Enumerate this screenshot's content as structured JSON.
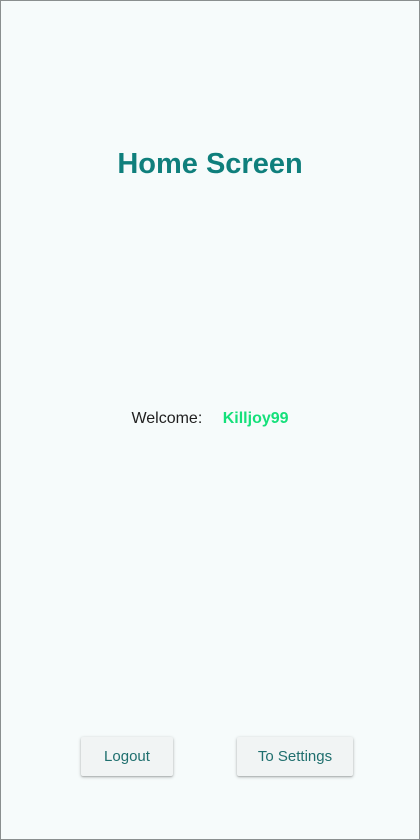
{
  "header": {
    "title": "Home Screen"
  },
  "welcome": {
    "label": "Welcome:",
    "username": "Killjoy99"
  },
  "actions": {
    "logout_label": "Logout",
    "settings_label": "To Settings"
  },
  "colors": {
    "background": "#f6fbfb",
    "title": "#0f7f7c",
    "username": "#14e07a",
    "button_bg": "#f1f4f4",
    "button_text": "#1f6f6e"
  }
}
